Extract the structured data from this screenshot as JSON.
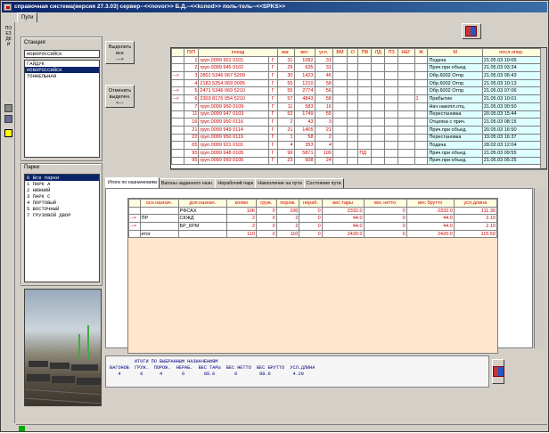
{
  "window": {
    "title": "справочная система(версия 27.3.03) сервер--<<novor>> Б.Д.--<<kcnod>> поль-тель--<<SPKS>>"
  },
  "top_tabs": [
    "Пути"
  ],
  "left_toolbar": {
    "vertical_text": "ПОЕЗДКИ"
  },
  "stations": {
    "label": "Станция",
    "current": "НОВОРОССИЙСК",
    "items": [
      "ГАЙДУК",
      "НОВОРОССИЙСК",
      "ТОННЕЛЬНАЯ"
    ],
    "selected_index": 1
  },
  "parks": {
    "label": "Парки",
    "items": [
      "0  Все парки",
      "1  ПАРК А",
      "2  НИЖНИЙ",
      "3  ПАРК С",
      "4  ПОРТОВЫЙ",
      "5  ВОСТОЧНЫЙ",
      "7  ГРУЗОВОЙ ДВОР"
    ],
    "selected_index": 0
  },
  "buttons": {
    "select_all": "Выделить все\n--->",
    "deselect": "Отменить выделен.\n<---"
  },
  "wagons_table": {
    "headers": [
      "П/П",
      "поезд",
      "ваг.",
      "вес",
      "усл.",
      "ВМ",
      "О",
      "ПВ",
      "ЛД",
      "ПЗ",
      "НЕГ",
      "Ж",
      "М",
      "посл.опер.",
      "время опер."
    ],
    "rows": [
      [
        "",
        "1",
        "груп.0099 901 0101",
        "Г",
        "31",
        "1082",
        "31",
        "",
        "",
        "",
        "",
        "",
        "",
        "",
        "Подача",
        "21.05.03 10:05"
      ],
      [
        "",
        "2",
        "груп.0099 945 0102",
        "Г",
        "29",
        "635",
        "31",
        "",
        "",
        "",
        "",
        "",
        "",
        "",
        "Прич.при объед.",
        "21.05.03 03:34"
      ],
      [
        "-->",
        "3",
        "2801 5346 067 5209",
        "Г",
        "30",
        "1423",
        "46",
        "",
        "",
        "",
        "",
        "",
        "",
        "",
        "Обр.6002 Отпр.",
        "21.05.03 06:43"
      ],
      [
        "",
        "4",
        "2183 5254 069 0095",
        "Г",
        "55",
        "1210",
        "58",
        "",
        "",
        "",
        "",
        "",
        "",
        "",
        "Обр.6002 Отпр.",
        "21.05.03 10:13"
      ],
      [
        "-->",
        "5",
        "2471 5346 069 5210",
        "Г",
        "55",
        "2774",
        "56",
        "",
        "",
        "",
        "",
        "",
        "",
        "",
        "Обр.6002 Отпр.",
        "21.05.03 07:06"
      ],
      [
        "-->",
        "6",
        "2303 8176 054 5210",
        "Г",
        "57",
        "4843",
        "58",
        "",
        "",
        "",
        "",
        "",
        "",
        "1",
        "Прибытие",
        "21.05.03 10:01"
      ],
      [
        "",
        "7",
        "груп.0099 950 0109",
        "Г",
        "11",
        "583",
        "16",
        "",
        "",
        "",
        "",
        "",
        "",
        "",
        "Нач.накопл.отц.",
        "21.05.03 00:50"
      ],
      [
        "",
        "11",
        "груп.0099 947 0103",
        "Г",
        "52",
        "1749",
        "55",
        "",
        "",
        "",
        "",
        "",
        "",
        "",
        "Перестановка",
        "20.05.03 15:44"
      ],
      [
        "",
        "16",
        "груп.0099 950 0116",
        "Г",
        "2",
        "43",
        "3",
        "",
        "",
        "",
        "",
        "",
        "",
        "",
        "Отцепка с прич.",
        "21.05.03 08:15"
      ],
      [
        "",
        "21",
        "груп.0099 949 0114",
        "Г",
        "21",
        "1405",
        "21",
        "",
        "",
        "",
        "",
        "",
        "",
        "",
        "Прич.при объед.",
        "20.05.03 16:50"
      ],
      [
        "",
        "22",
        "груп.0099 950 0119",
        "Г",
        "1",
        "58",
        "2",
        "",
        "",
        "",
        "",
        "",
        "",
        "",
        "Перестановка",
        "19.05.03 16:37"
      ],
      [
        "",
        "65",
        "груп.0099 921 0101",
        "Г",
        "4",
        "353",
        "4",
        "",
        "",
        "",
        "",
        "",
        "",
        "",
        "Подача",
        "28.02.03 12:04"
      ],
      [
        "",
        "95",
        "груп.0099 948 0105",
        "Г",
        "99",
        "5871",
        "109",
        "",
        "",
        "ПД",
        "",
        "",
        "",
        "",
        "Прич.при объед.",
        "21.05.03 09:55"
      ],
      [
        "",
        "95",
        "груп.0099 950 0106",
        "Г",
        "23",
        "508",
        "24",
        "",
        "",
        "",
        "",
        "",
        "",
        "",
        "Прич.при объед.",
        "21.05.03 05:25"
      ]
    ]
  },
  "bottom_tabs": {
    "items": [
      "Итоги по назначениям",
      "Вагоны заданного назн.",
      "Нерабочий парк",
      "Накопление на пути",
      "Состояние пути"
    ],
    "active_index": 0
  },
  "totals_table": {
    "headers": [
      "осн.назнач.",
      "доп.назнач.",
      "колво",
      "груж.",
      "порож.",
      "нераб.",
      "вес тары",
      "вес нетто",
      "вес брутто",
      "усл.длина"
    ],
    "rows": [
      [
        "",
        "",
        "РФСАХ",
        "106",
        "0",
        "106",
        "0",
        "2332.0",
        "0",
        "2332.0",
        "111.30"
      ],
      [
        "-->",
        "ПР",
        "СКЖД",
        "2",
        "0",
        "2",
        "0",
        "44.0",
        "0",
        "44.0",
        "2.10"
      ],
      [
        "-->",
        "",
        "БР_КРМ",
        "2",
        "0",
        "2",
        "0",
        "44.0",
        "0",
        "44.0",
        "2.10"
      ],
      [
        "",
        "итог",
        "",
        "110",
        "0",
        "110",
        "0",
        "2420.0",
        "0",
        "2420.0",
        "115.50"
      ]
    ]
  },
  "summary": {
    "title": "ИТОГИ ПО ВЫБРАННЫМ НАЗНАЧЕНИЯМ",
    "headers": "ВАГОНОВ  ГРУЖ.  ПОРОЖ.  НЕРАБ.  ВЕС ТАРЫ  ВЕС НЕТТО  ВЕС БРУТТО  УСЛ.ДЛИНА",
    "values": "   4       0      4       0       88.0       0        88.0        4.20"
  },
  "colors": {
    "title_bar": "#0a246a",
    "selection": "#0a246a",
    "header_text": "#c00000",
    "op_cell": "#ddffff",
    "totals_bg": "#ffe6cc"
  }
}
